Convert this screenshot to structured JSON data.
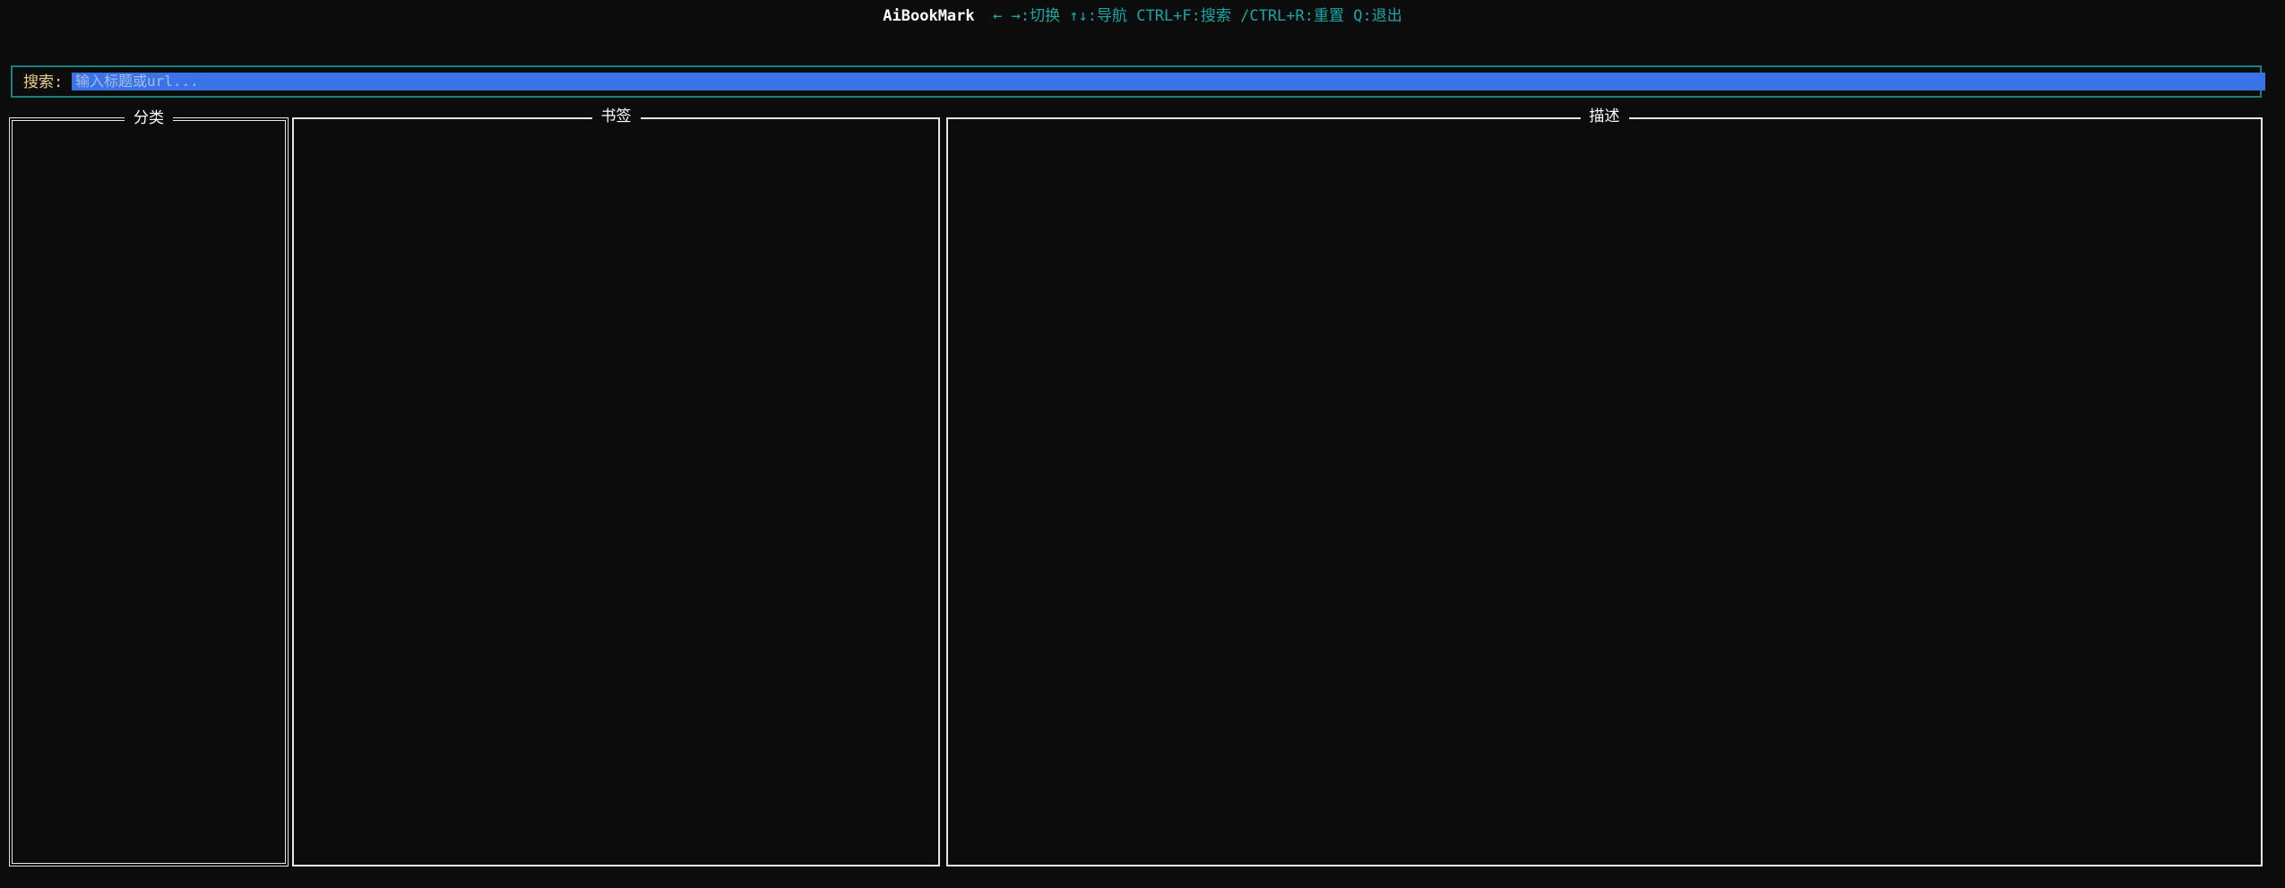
{
  "header": {
    "app_name": "AiBookMark",
    "hints": "← →:切换 ↑↓:导航 CTRL+F:搜索 /CTRL+R:重置 Q:退出"
  },
  "search": {
    "label": "搜索:",
    "value": "",
    "placeholder": "输入标题或url..."
  },
  "panels": {
    "categories": {
      "title": "分类",
      "items": []
    },
    "bookmarks": {
      "title": "书签",
      "items": []
    },
    "description": {
      "title": "描述",
      "text": ""
    }
  },
  "colors": {
    "background": "#0c0c0c",
    "hint_text": "#19a6a6",
    "search_border": "#1c7f80",
    "search_label": "#e7d28a",
    "search_input_bg": "#3a72e8",
    "panel_border": "#e6e6e6"
  }
}
